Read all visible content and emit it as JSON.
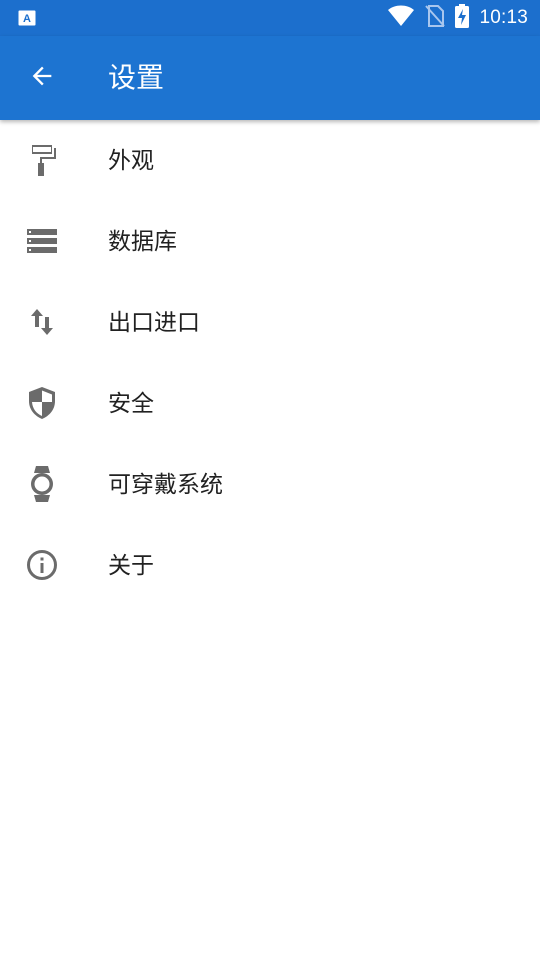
{
  "status_bar": {
    "time": "10:13",
    "left_icon": "a-notification-icon",
    "icons": [
      "wifi-icon",
      "no-sim-icon",
      "battery-charging-icon"
    ]
  },
  "app_bar": {
    "title": "设置",
    "back_icon": "arrow-back-icon"
  },
  "settings": {
    "items": [
      {
        "label": "外观",
        "icon": "paint-roller-icon"
      },
      {
        "label": "数据库",
        "icon": "storage-icon"
      },
      {
        "label": "出口进口",
        "icon": "import-export-icon"
      },
      {
        "label": "安全",
        "icon": "security-shield-icon"
      },
      {
        "label": "可穿戴系统",
        "icon": "watch-icon"
      },
      {
        "label": "关于",
        "icon": "info-icon"
      }
    ]
  },
  "colors": {
    "status_bar": "#1c6fcd",
    "app_bar": "#1d74d1",
    "icon_gray": "#6b6b6b",
    "text": "#212121",
    "background": "#ffffff"
  }
}
